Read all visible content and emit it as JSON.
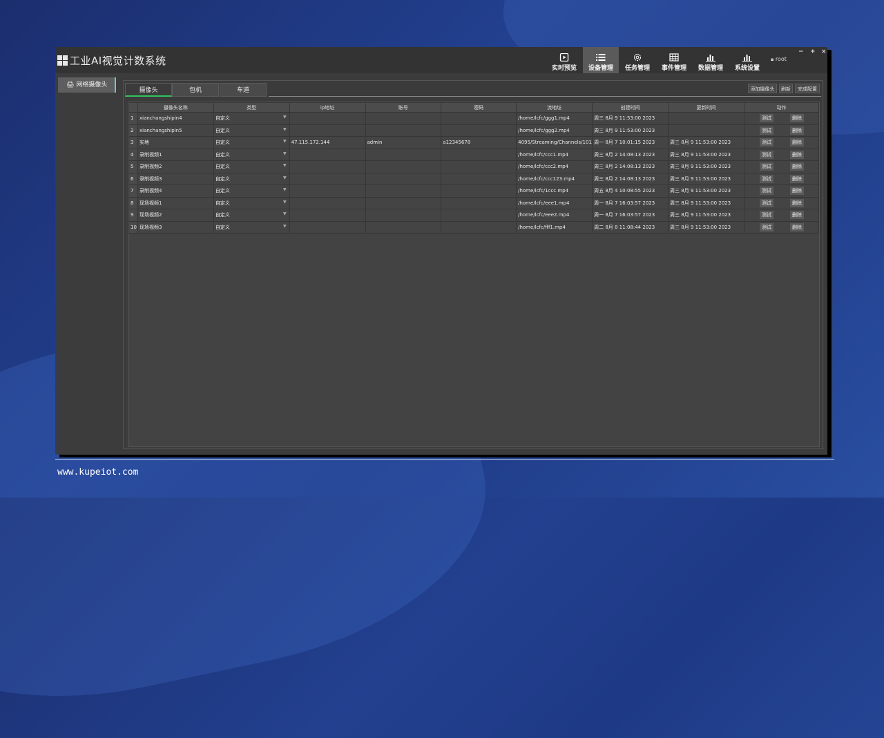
{
  "app": {
    "title": "工业AI视觉计数系统",
    "user": "root",
    "window_controls": [
      "−",
      "+",
      "×"
    ]
  },
  "nav": [
    {
      "label": "实时预览",
      "icon": "play-icon",
      "active": false
    },
    {
      "label": "设备管理",
      "icon": "list-icon",
      "active": true
    },
    {
      "label": "任务管理",
      "icon": "gear-icon",
      "active": false
    },
    {
      "label": "事件管理",
      "icon": "grid-icon",
      "active": false
    },
    {
      "label": "数据管理",
      "icon": "bar-chart-icon",
      "active": false
    },
    {
      "label": "系统设置",
      "icon": "bar-chart-icon",
      "active": false
    }
  ],
  "sidebar": {
    "items": [
      {
        "label": "网络摄像头",
        "icon": "printer-icon"
      }
    ]
  },
  "tabs": [
    {
      "label": "摄像头",
      "active": true
    },
    {
      "label": "包机",
      "active": false
    },
    {
      "label": "车道",
      "active": false
    }
  ],
  "toolbar": {
    "add": "添加摄像头",
    "refresh": "刷新",
    "finish": "完成配置"
  },
  "table": {
    "headers": [
      "摄像头名称",
      "类型",
      "ip地址",
      "账号",
      "密码",
      "流地址",
      "创建时间",
      "更新时间",
      "动作"
    ],
    "test_label": "测试",
    "delete_label": "删除",
    "rows": [
      {
        "idx": "1",
        "name": "xianchangshipin4",
        "type": "自定义",
        "ip": "",
        "account": "",
        "password": "",
        "stream": "/home/lcfc/ggg1.mp4",
        "created": "周三 8月 9 11:53:00 2023",
        "updated": ""
      },
      {
        "idx": "2",
        "name": "xianchangshipin5",
        "type": "自定义",
        "ip": "",
        "account": "",
        "password": "",
        "stream": "/home/lcfc/ggg2.mp4",
        "created": "周三 8月 9 11:53:00 2023",
        "updated": ""
      },
      {
        "idx": "3",
        "name": "实地",
        "type": "自定义",
        "ip": "47.115.172.144",
        "account": "admin",
        "password": "a12345678",
        "stream": "4095/Streaming/Channels/101",
        "created": "周一 8月 7 10:01:15 2023",
        "updated": "周三 8月 9 11:53:00 2023"
      },
      {
        "idx": "4",
        "name": "录制视频1",
        "type": "自定义",
        "ip": "",
        "account": "",
        "password": "",
        "stream": "/home/lcfc/ccc1.mp4",
        "created": "周三 8月 2 14:08:13 2023",
        "updated": "周三 8月 9 11:53:00 2023"
      },
      {
        "idx": "5",
        "name": "录制视频2",
        "type": "自定义",
        "ip": "",
        "account": "",
        "password": "",
        "stream": "/home/lcfc/ccc2.mp4",
        "created": "周三 8月 2 14:08:13 2023",
        "updated": "周三 8月 9 11:53:00 2023"
      },
      {
        "idx": "6",
        "name": "录制视频3",
        "type": "自定义",
        "ip": "",
        "account": "",
        "password": "",
        "stream": "/home/lcfc/ccc123.mp4",
        "created": "周三 8月 2 14:08:13 2023",
        "updated": "周三 8月 9 11:53:00 2023"
      },
      {
        "idx": "7",
        "name": "录制视频4",
        "type": "自定义",
        "ip": "",
        "account": "",
        "password": "",
        "stream": "/home/lcfc/1ccc.mp4",
        "created": "周五 8月 4 10:08:55 2023",
        "updated": "周三 8月 9 11:53:00 2023"
      },
      {
        "idx": "8",
        "name": "现场视频1",
        "type": "自定义",
        "ip": "",
        "account": "",
        "password": "",
        "stream": "/home/lcfc/eee1.mp4",
        "created": "周一 8月 7 16:03:57 2023",
        "updated": "周三 8月 9 11:53:00 2023"
      },
      {
        "idx": "9",
        "name": "现场视频2",
        "type": "自定义",
        "ip": "",
        "account": "",
        "password": "",
        "stream": "/home/lcfc/eee2.mp4",
        "created": "周一 8月 7 16:03:57 2023",
        "updated": "周三 8月 9 11:53:00 2023"
      },
      {
        "idx": "10",
        "name": "现场视频3",
        "type": "自定义",
        "ip": "",
        "account": "",
        "password": "",
        "stream": "/home/lcfc/fff1.mp4",
        "created": "周二 8月 8 11:08:44 2023",
        "updated": "周三 8月 9 11:53:00 2023"
      }
    ]
  },
  "footer": {
    "website": "www.kupeiot.com"
  }
}
